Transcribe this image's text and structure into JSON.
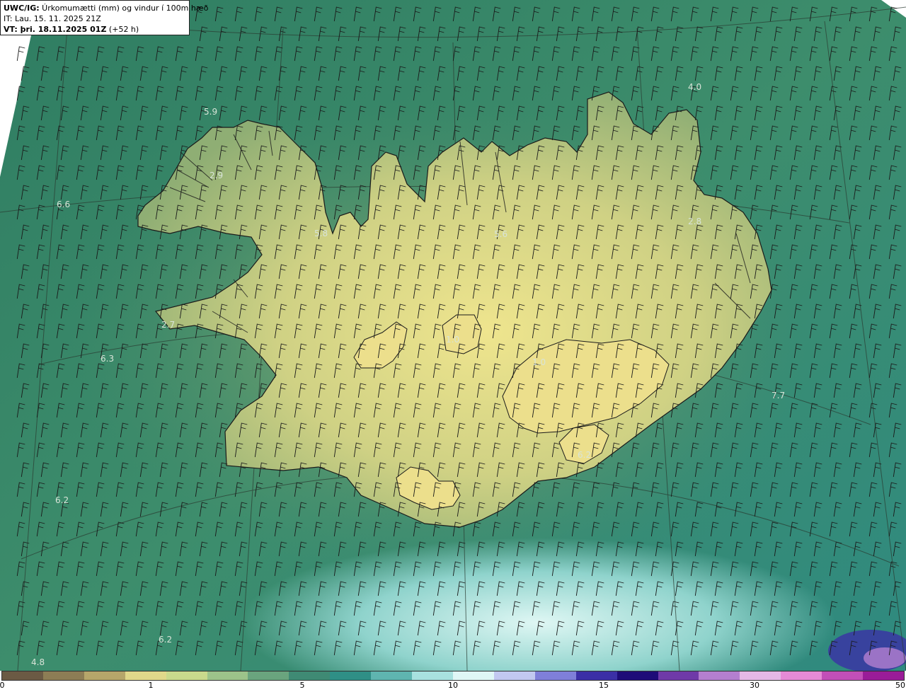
{
  "header": {
    "title_bold": "UWC/IG:",
    "title_rest": " Úrkomumætti (mm) og vindur í 100m hæð",
    "it_line": "IT: Lau. 15. 11. 2025 21Z",
    "vt_bold": "VT: þri. 18.11.2025 01Z",
    "vt_rest": " (+52 h)"
  },
  "colorbar": {
    "ticks": [
      "0",
      "1",
      "5",
      "10",
      "15",
      "30",
      "50"
    ],
    "segments": [
      {
        "color": "#6b5a44"
      },
      {
        "color": "#8d7d55"
      },
      {
        "color": "#b6a66a"
      },
      {
        "color": "#e0d88a"
      },
      {
        "color": "#c9d98c"
      },
      {
        "color": "#9cc38a"
      },
      {
        "color": "#6aa47e"
      },
      {
        "color": "#3f8a74"
      },
      {
        "color": "#2f8f86"
      },
      {
        "color": "#5fb5b0"
      },
      {
        "color": "#a8e1df"
      },
      {
        "color": "#dff7f6"
      },
      {
        "color": "#c2c8f0"
      },
      {
        "color": "#7f7fd9"
      },
      {
        "color": "#3b2fa6"
      },
      {
        "color": "#1e0c78"
      },
      {
        "color": "#6f3aa8"
      },
      {
        "color": "#b47fcf"
      },
      {
        "color": "#e5b8e6"
      },
      {
        "color": "#e58ad6"
      },
      {
        "color": "#c24fb8"
      },
      {
        "color": "#9a1c98"
      }
    ]
  },
  "map_values": [
    {
      "text": "5.9"
    },
    {
      "text": "2.9"
    },
    {
      "text": "6.6"
    },
    {
      "text": "5.8"
    },
    {
      "text": "5.6"
    },
    {
      "text": "4.0"
    },
    {
      "text": "2.8"
    },
    {
      "text": "2.7"
    },
    {
      "text": "6.3"
    },
    {
      "text": "1.0"
    },
    {
      "text": "1.0"
    },
    {
      "text": "7.7"
    },
    {
      "text": "6.2"
    },
    {
      "text": "6.2"
    },
    {
      "text": "6.2"
    },
    {
      "text": "4.8"
    }
  ],
  "colors": {
    "ocean": "#3c8a6e",
    "land_high": "#e8e08a",
    "land_mid": "#a8b878",
    "coast": "#1a1a1a"
  }
}
